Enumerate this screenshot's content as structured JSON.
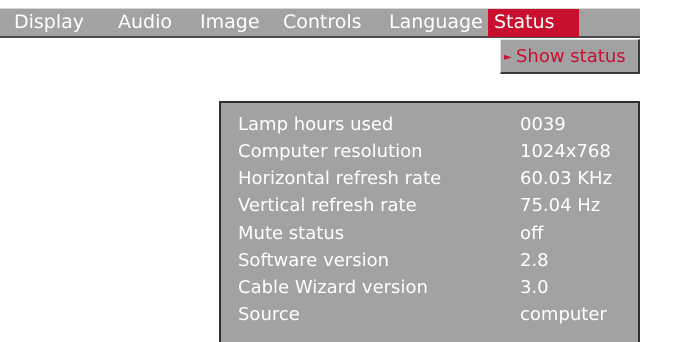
{
  "menu": {
    "items": [
      {
        "label": "Display"
      },
      {
        "label": "Audio"
      },
      {
        "label": "Image"
      },
      {
        "label": "Controls"
      },
      {
        "label": "Language"
      },
      {
        "label": "Status",
        "active": true
      }
    ]
  },
  "dropdown": {
    "items": [
      {
        "label": "Show status",
        "selected": true
      }
    ]
  },
  "status": {
    "rows": [
      {
        "label": "Lamp hours used",
        "value": "0039"
      },
      {
        "label": "Computer resolution",
        "value": "1024x768"
      },
      {
        "label": "Horizontal refresh rate",
        "value": "60.03 KHz"
      },
      {
        "label": "Vertical refresh rate",
        "value": "75.04 Hz"
      },
      {
        "label": "Mute status",
        "value": "off"
      },
      {
        "label": "Software version",
        "value": "2.8"
      },
      {
        "label": "Cable Wizard version",
        "value": "3.0"
      },
      {
        "label": "Source",
        "value": "computer"
      }
    ]
  },
  "colors": {
    "menu_background": "#a2a2a2",
    "active_highlight": "#c8102e",
    "text": "#ffffff"
  }
}
